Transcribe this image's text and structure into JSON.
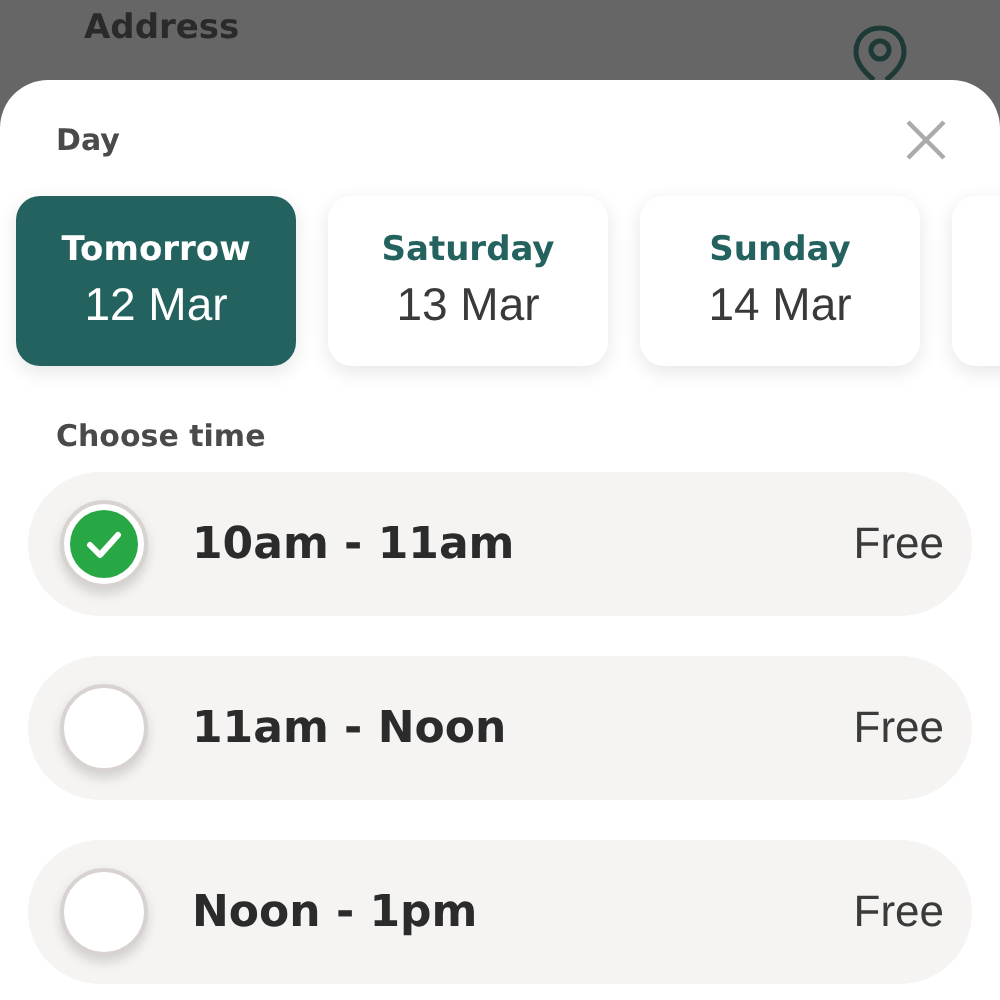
{
  "background": {
    "label": "Address"
  },
  "day_section": {
    "title": "Day"
  },
  "days": [
    {
      "label": "Tomorrow",
      "date": "12 Mar",
      "selected": true
    },
    {
      "label": "Saturday",
      "date": "13 Mar",
      "selected": false
    },
    {
      "label": "Sunday",
      "date": "14 Mar",
      "selected": false
    },
    {
      "selected": false
    }
  ],
  "time_section": {
    "title": "Choose time"
  },
  "slots": [
    {
      "label": "10am - 11am",
      "price": "Free",
      "selected": true
    },
    {
      "label": "11am - Noon",
      "price": "Free",
      "selected": false
    },
    {
      "label": "Noon - 1pm",
      "price": "Free",
      "selected": false
    }
  ]
}
